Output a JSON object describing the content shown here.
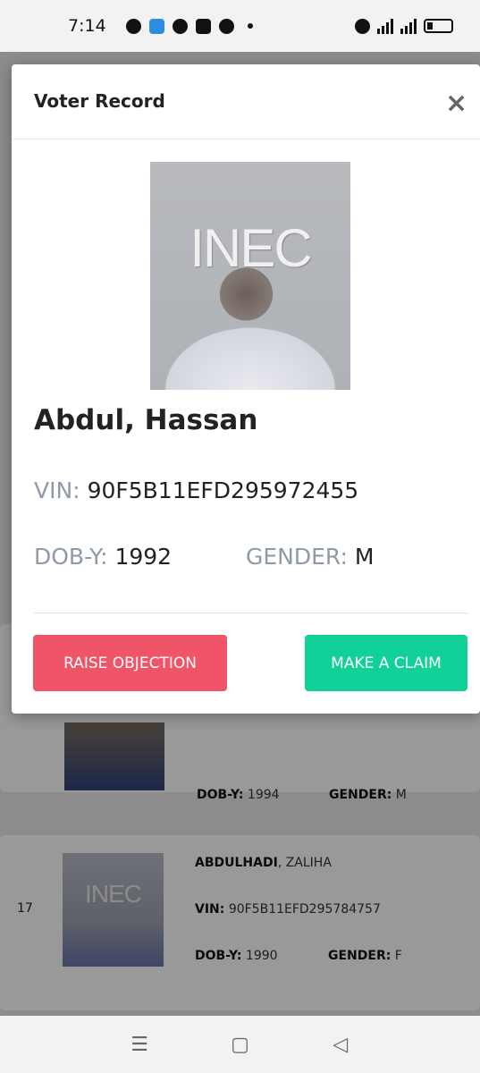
{
  "status_bar": {
    "time": "7:14"
  },
  "background_list": [
    {
      "index": "",
      "dob_label": "DOB-Y:",
      "dob": "1994",
      "gender_label": "GENDER:",
      "gender": "M"
    },
    {
      "index": "17",
      "surname": "ABDULHADI",
      "given": ", ZALIHA",
      "vin_label": "VIN:",
      "vin": "90F5B11EFD295784757",
      "dob_label": "DOB-Y:",
      "dob": "1990",
      "gender_label": "GENDER:",
      "gender": "F",
      "photo_mark": "INEC"
    }
  ],
  "modal": {
    "title": "Voter Record",
    "close_icon": "×",
    "photo_mark": "INEC",
    "name": "Abdul, Hassan",
    "vin_label": "VIN:",
    "vin": "90F5B11EFD295972455",
    "dob_label": "DOB-Y:",
    "dob": "1992",
    "gender_label": "GENDER:",
    "gender": "M",
    "raise_objection": "RAISE OBJECTION",
    "make_claim": "MAKE A CLAIM"
  },
  "colors": {
    "raise_objection": "#ef5468",
    "make_claim": "#11d199",
    "label_gray": "#8e9aa8"
  },
  "nav": {
    "menu_icon": "☰",
    "home_icon": "▢",
    "back_icon": "◁"
  }
}
